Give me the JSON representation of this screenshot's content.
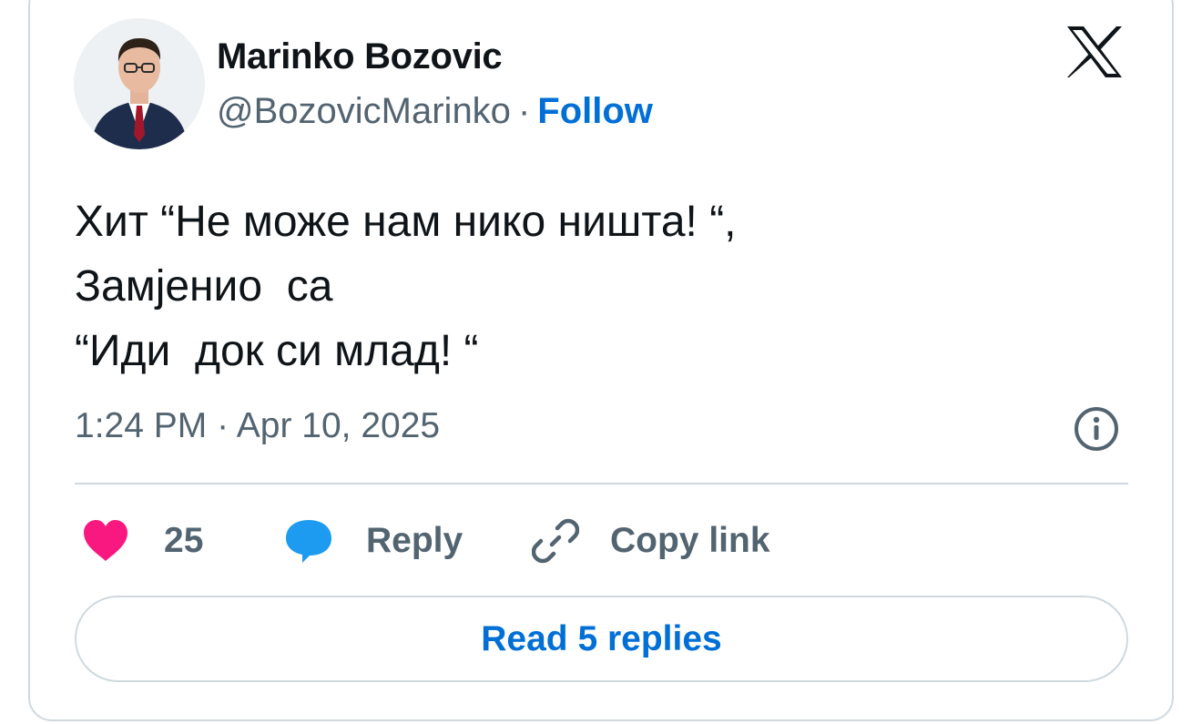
{
  "author": {
    "name": "Marinko Bozovic",
    "handle": "@BozovicMarinko",
    "separator": "·",
    "follow_label": "Follow"
  },
  "tweet": {
    "text": "Хит “Не може нам нико ништа! “,\nЗамјенио  са\n“Иди  док си млад! “",
    "timestamp": "1:24 PM · Apr 10, 2025"
  },
  "actions": {
    "like_count": "25",
    "reply_label": "Reply",
    "copy_link_label": "Copy link"
  },
  "footer": {
    "read_replies_label": "Read 5 replies"
  },
  "icons": {
    "brand": "x-logo-icon",
    "info": "info-icon",
    "like": "heart-icon",
    "reply": "speech-bubble-icon",
    "copy": "link-icon"
  },
  "colors": {
    "link_blue": "#006fd6",
    "heart_pink": "#f91880",
    "reply_blue": "#1d9bf0",
    "secondary_text": "#536471",
    "border": "#cfd9de"
  }
}
